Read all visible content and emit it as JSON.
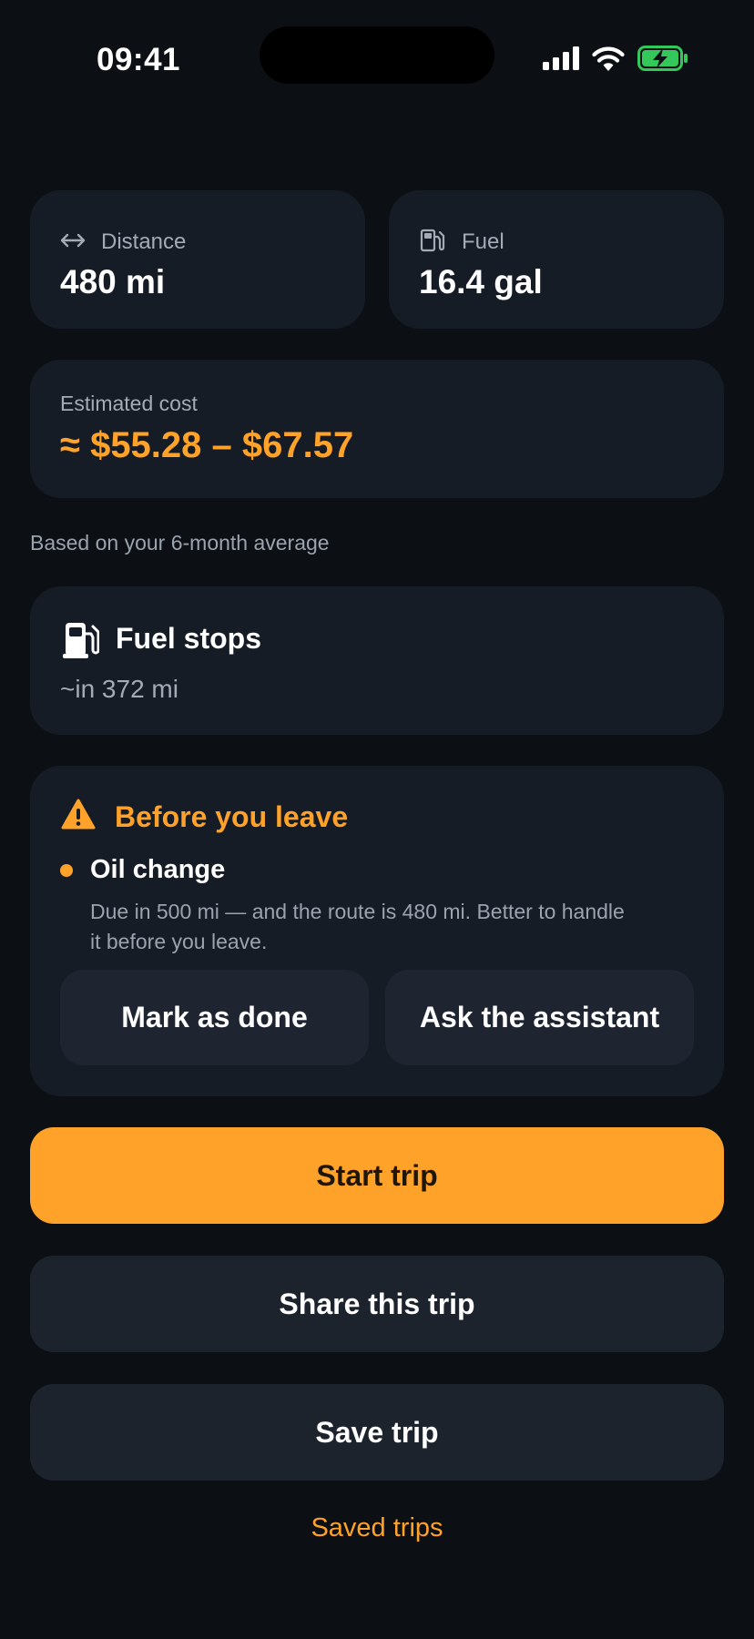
{
  "status_bar": {
    "time": "09:41"
  },
  "summary": {
    "distance": {
      "label": "Distance",
      "value": "480 mi",
      "icon": "arrows-horizontal-icon"
    },
    "fuel": {
      "label": "Fuel",
      "value": "16.4 gal",
      "icon": "fuel-pump-icon"
    }
  },
  "cost": {
    "label": "Estimated cost",
    "value": "≈ $55.28 – $67.57"
  },
  "note": "Based on your 6-month average",
  "fuel_stops": {
    "title": "Fuel stops",
    "subtitle": "~in 372 mi",
    "icon": "fuel-pump-icon"
  },
  "warning": {
    "title": "Before you leave",
    "icon": "warning-triangle-icon",
    "item": {
      "title": "Oil change",
      "description": "Due in 500 mi — and the route is 480 mi. Better to handle it before you leave."
    },
    "actions": {
      "mark_done": "Mark as done",
      "ask_assistant": "Ask the assistant"
    }
  },
  "buttons": {
    "start": "Start trip",
    "share": "Share this trip",
    "save": "Save trip"
  },
  "link": "Saved trips",
  "colors": {
    "accent": "#ffa229",
    "card": "#161c25",
    "background": "#0c1015",
    "battery": "#34c759"
  }
}
